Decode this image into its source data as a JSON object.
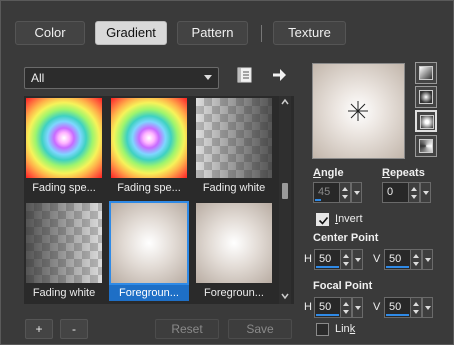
{
  "tabs": [
    {
      "label": "Color",
      "active": false
    },
    {
      "label": "Gradient",
      "active": true
    },
    {
      "label": "Pattern",
      "active": false
    },
    {
      "label": "Texture",
      "active": false
    }
  ],
  "category": {
    "selected": "All"
  },
  "thumbnails": [
    {
      "caption": "Fading spe...",
      "style": "rainbow",
      "selected": false
    },
    {
      "caption": "Fading spe...",
      "style": "rainbow",
      "selected": false
    },
    {
      "caption": "Fading white",
      "style": "checker-fade-right",
      "selected": false
    },
    {
      "caption": "Fading white",
      "style": "checker-fade-left",
      "selected": false
    },
    {
      "caption": "Foregroun...",
      "style": "foreground",
      "selected": true
    },
    {
      "caption": "Foregroun...",
      "style": "foreground",
      "selected": false
    }
  ],
  "buttons": {
    "add": "+",
    "remove": "-",
    "reset": "Reset",
    "save": "Save"
  },
  "angle": {
    "label_prefix": "",
    "label_underline": "A",
    "label_rest": "ngle",
    "value": "45",
    "enabled": false
  },
  "repeats": {
    "label_underline": "R",
    "label_rest": "epeats",
    "value": "0"
  },
  "invert": {
    "label_underline": "I",
    "label_rest": "nvert",
    "checked": true
  },
  "center_point": {
    "label": "Center Point",
    "h_label": "H",
    "h_value": "50",
    "v_label": "V",
    "v_value": "50"
  },
  "focal_point": {
    "label": "Focal Point",
    "h_label": "H",
    "h_value": "50",
    "v_label": "V",
    "v_value": "50"
  },
  "link": {
    "label_prefix": "Lin",
    "label_underline": "k",
    "checked": false
  },
  "colors": {
    "accent": "#2f8ae6",
    "selection": "#1e6fc6",
    "panel": "#3a3a3a"
  }
}
